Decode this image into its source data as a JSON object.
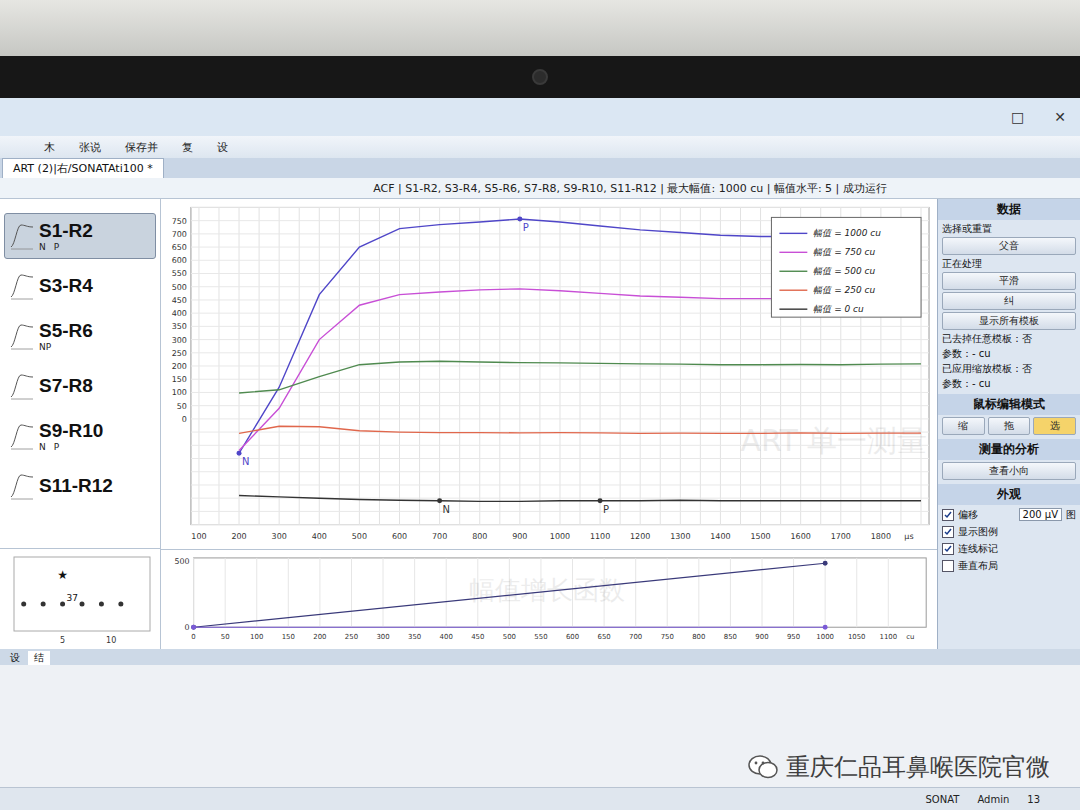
{
  "window": {
    "title": "ART (2)|右/SONATAti100 *",
    "controls": [
      "□",
      "✕"
    ]
  },
  "toolbar": [
    "木",
    "张说",
    "保存并",
    "复",
    "设"
  ],
  "info_bar": "ACF | S1-R2, S3-R4, S5-R6, S7-R8, S9-R10, S11-R12 | 最大幅值: 1000 cu | 幅值水平: 5 | 成功运行",
  "channels": [
    {
      "label": "S1-R2",
      "selected": true,
      "markers": [
        "N",
        "P"
      ]
    },
    {
      "label": "S3-R4",
      "selected": false,
      "markers": []
    },
    {
      "label": "S5-R6",
      "selected": false,
      "markers": [
        "NP"
      ]
    },
    {
      "label": "S7-R8",
      "selected": false,
      "markers": []
    },
    {
      "label": "S9-R10",
      "selected": false,
      "markers": [
        "N",
        "P"
      ]
    },
    {
      "label": "S11-R12",
      "selected": false,
      "markers": []
    }
  ],
  "chart": {
    "x_unit": "μs",
    "x_ticks": [
      "100",
      "200",
      "300",
      "400",
      "500",
      "600",
      "700",
      "800",
      "900",
      "1000",
      "1100",
      "1200",
      "1300",
      "1400",
      "1500",
      "1600",
      "1700",
      "1800"
    ],
    "y_ticks": [
      "0",
      "50",
      "100",
      "150",
      "200",
      "250",
      "300",
      "350",
      "400",
      "450",
      "500",
      "550",
      "600",
      "650",
      "700",
      "750"
    ],
    "x": [
      200,
      300,
      400,
      500,
      600,
      700,
      800,
      900,
      1000,
      1100,
      1200,
      1300,
      1400,
      1500,
      1600,
      1700,
      1800,
      1900
    ],
    "series": [
      {
        "name": "幅值 = 1000 cu",
        "color": "#4f46c8",
        "values": [
          -130,
          120,
          470,
          650,
          720,
          735,
          745,
          756,
          745,
          730,
          715,
          705,
          695,
          690,
          690,
          695,
          700,
          705
        ]
      },
      {
        "name": "幅值 = 750 cu",
        "color": "#c84fd6",
        "values": [
          -120,
          40,
          300,
          430,
          470,
          480,
          488,
          492,
          485,
          475,
          465,
          460,
          455,
          455,
          455,
          455,
          458,
          460
        ]
      },
      {
        "name": "幅值 = 500 cu",
        "color": "#4f8a4f",
        "values": [
          98,
          110,
          160,
          205,
          215,
          218,
          215,
          213,
          212,
          210,
          208,
          207,
          205,
          205,
          206,
          205,
          207,
          208
        ]
      },
      {
        "name": "幅值 = 250 cu",
        "color": "#e0674c",
        "values": [
          -55,
          -28,
          -30,
          -45,
          -50,
          -52,
          -52,
          -53,
          -52,
          -53,
          -55,
          -54,
          -55,
          -55,
          -53,
          -55,
          -54,
          -54
        ]
      },
      {
        "name": "幅值 = 0 cu",
        "color": "#333333",
        "values": [
          -290,
          -295,
          -300,
          -305,
          -308,
          -310,
          -312,
          -312,
          -310,
          -310,
          -310,
          -308,
          -310,
          -310,
          -310,
          -310,
          -310,
          -310
        ]
      }
    ],
    "markers": [
      {
        "label": "N",
        "series": 0,
        "index": 0
      },
      {
        "label": "P",
        "series": 0,
        "index": 7
      },
      {
        "label": "N",
        "series": 4,
        "index": 5
      },
      {
        "label": "P",
        "series": 4,
        "index": 9
      }
    ],
    "watermark": "ART 单一测量"
  },
  "growth_chart": {
    "x_unit": "cu",
    "x_ticks": [
      "0",
      "50",
      "100",
      "150",
      "200",
      "250",
      "300",
      "350",
      "400",
      "450",
      "500",
      "550",
      "600",
      "650",
      "700",
      "750",
      "800",
      "850",
      "900",
      "950",
      "1000",
      "1050",
      "1100"
    ],
    "y_ticks": [
      "0",
      "500"
    ],
    "x": [
      0,
      1000
    ],
    "series": [
      {
        "color": "#3a3a7a",
        "values": [
          0,
          480
        ]
      },
      {
        "color": "#7a5ad6",
        "values": [
          0,
          0
        ]
      }
    ],
    "watermark": "幅值增长函数"
  },
  "scatter": {
    "x_ticks": [
      "5",
      "10"
    ],
    "points": [
      [
        1,
        30
      ],
      [
        3,
        30
      ],
      [
        5,
        30
      ],
      [
        7,
        30
      ],
      [
        9,
        30
      ],
      [
        11,
        30
      ]
    ],
    "star": {
      "glyph": "★",
      "x": 5,
      "y": 58
    },
    "label": "37"
  },
  "side_panel": [
    {
      "title": "数据",
      "rows": [
        {
          "kind": "label",
          "text": "选择或重置"
        },
        {
          "kind": "button",
          "text": "父音"
        },
        {
          "kind": "label",
          "text": "正在处理"
        },
        {
          "kind": "button",
          "text": "平滑"
        },
        {
          "kind": "button",
          "text": "纠"
        },
        {
          "kind": "button",
          "text": "显示所有模板"
        },
        {
          "kind": "label",
          "text": "已去掉任意模板：否"
        },
        {
          "kind": "label",
          "text": "参数：- cu"
        },
        {
          "kind": "label",
          "text": "已应用缩放模板：否"
        },
        {
          "kind": "label",
          "text": "参数：- cu"
        }
      ]
    },
    {
      "title": "鼠标编辑模式",
      "rows": [
        {
          "kind": "buttons",
          "items": [
            {
              "text": "缩",
              "selected": false
            },
            {
              "text": "拖",
              "selected": false
            },
            {
              "text": "选",
              "selected": true
            }
          ]
        }
      ]
    },
    {
      "title": "测量的分析",
      "rows": [
        {
          "kind": "button",
          "text": "查看小向"
        }
      ]
    },
    {
      "title": "外观",
      "rows": [
        {
          "kind": "check",
          "text": "偏移",
          "checked": true,
          "field": "200 μV",
          "unit": "图"
        },
        {
          "kind": "check",
          "text": "显示图例",
          "checked": true
        },
        {
          "kind": "check",
          "text": "连线标记",
          "checked": true
        },
        {
          "kind": "check",
          "text": "垂直布局",
          "checked": false
        }
      ]
    }
  ],
  "status_tabs": [
    {
      "label": "设",
      "selected": false
    },
    {
      "label": "结",
      "selected": true
    }
  ],
  "taskbar": [
    "SONAT",
    "Admin",
    "13"
  ],
  "watermark": "重庆仁品耳鼻喉医院官微"
}
